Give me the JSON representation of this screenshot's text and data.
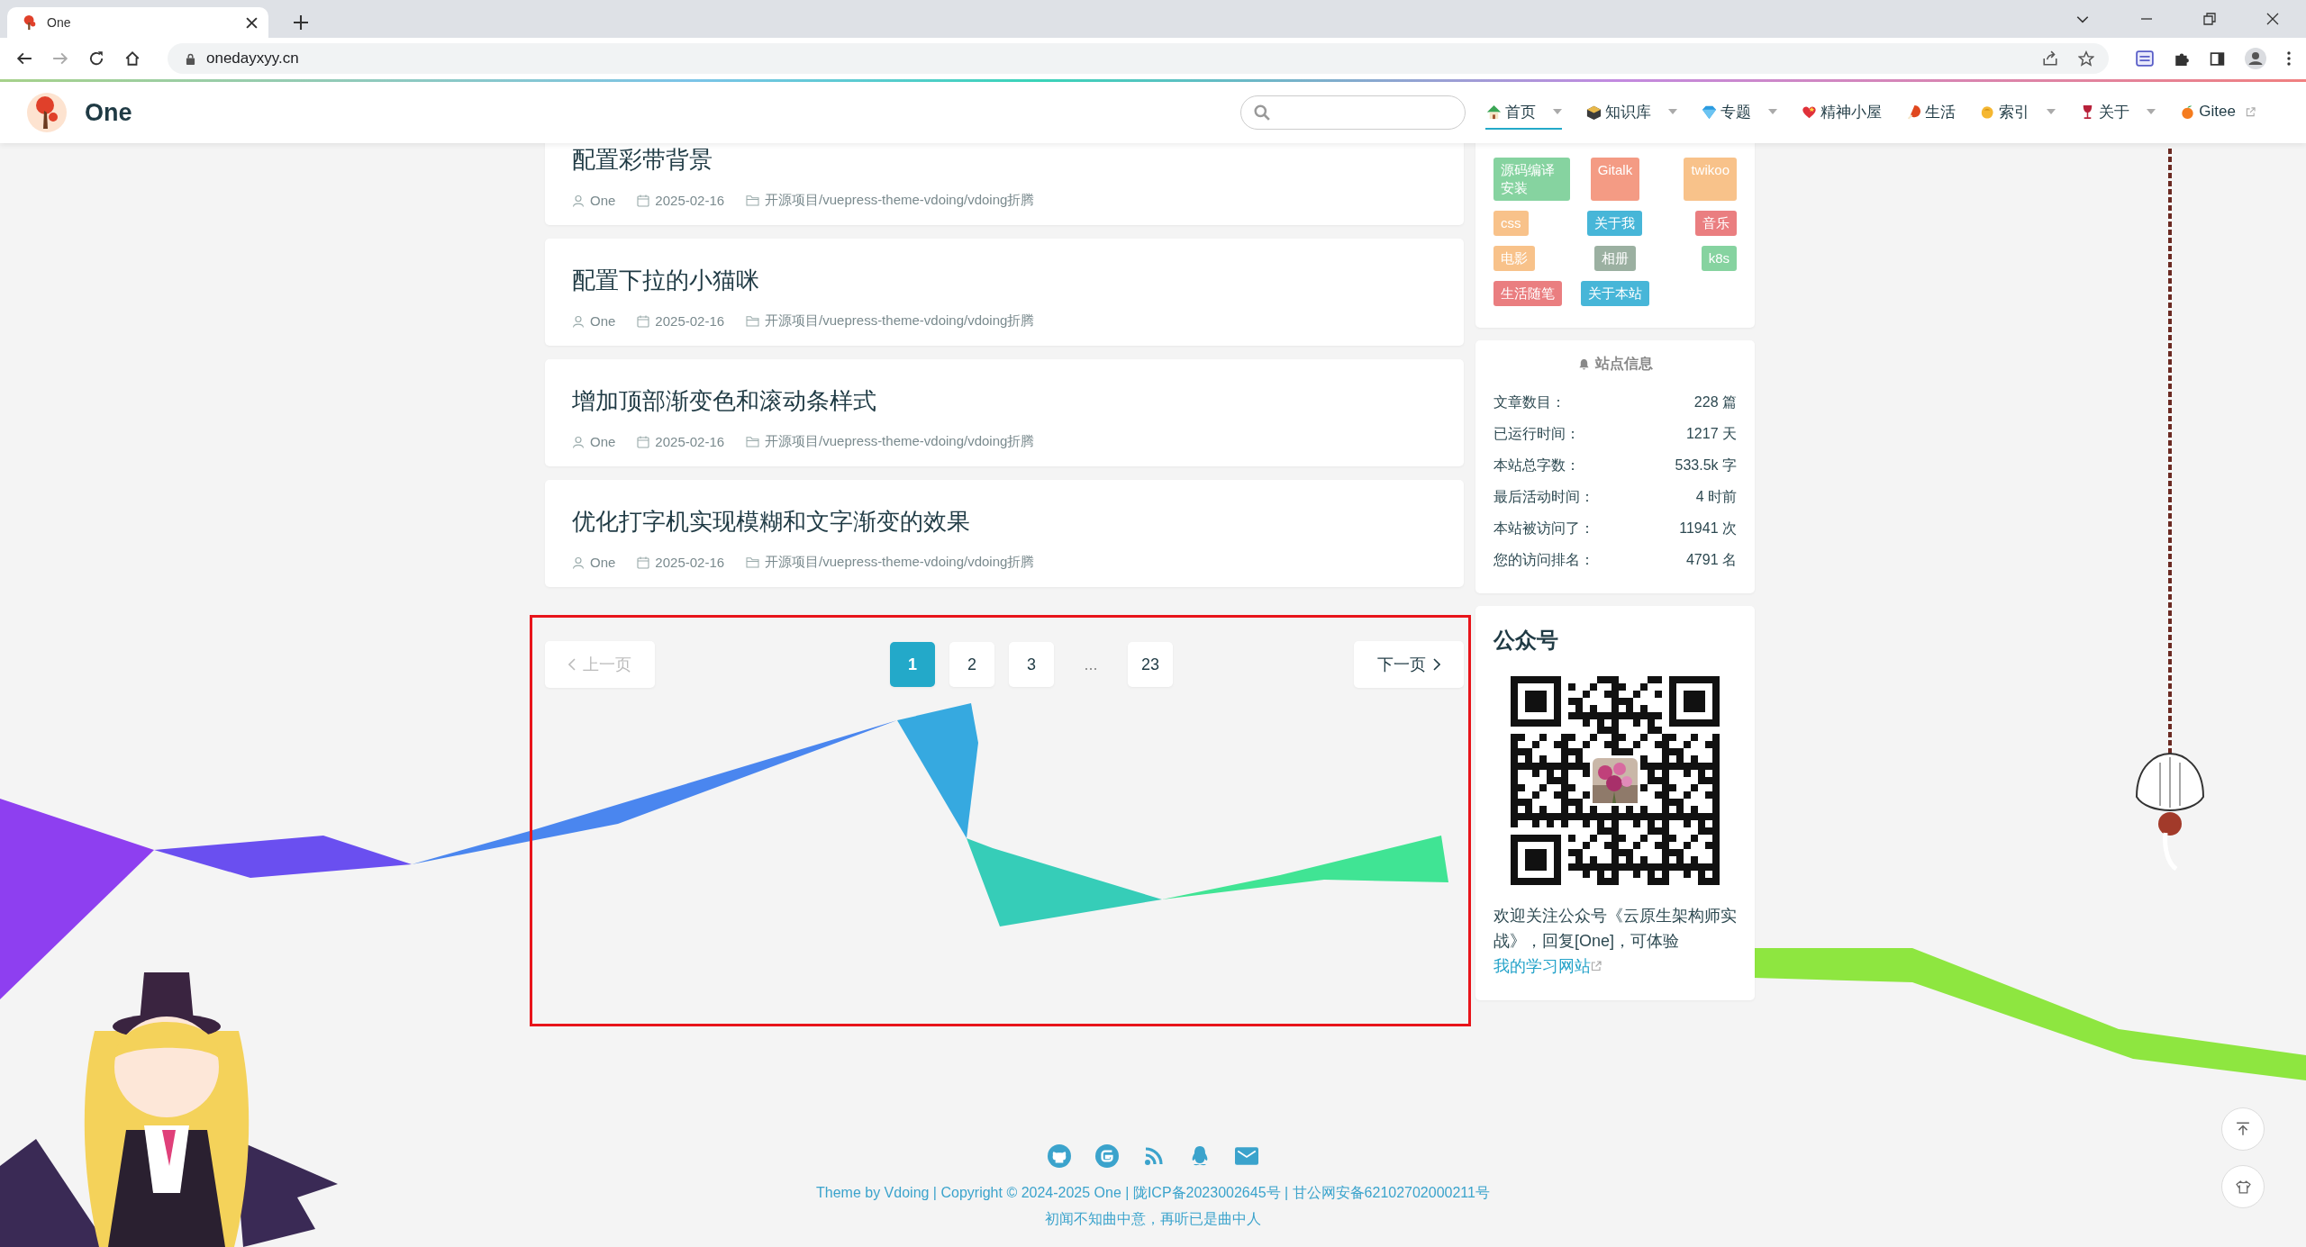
{
  "browser": {
    "tab_title": "One",
    "url": "onedayxyy.cn"
  },
  "site": {
    "title": "One"
  },
  "nav": [
    {
      "label": "首页",
      "selected": true,
      "dropdown": true,
      "external": false
    },
    {
      "label": "知识库",
      "selected": false,
      "dropdown": true,
      "external": false
    },
    {
      "label": "专题",
      "selected": false,
      "dropdown": true,
      "external": false
    },
    {
      "label": "精神小屋",
      "selected": false,
      "dropdown": false,
      "external": false
    },
    {
      "label": "生活",
      "selected": false,
      "dropdown": false,
      "external": false
    },
    {
      "label": "索引",
      "selected": false,
      "dropdown": true,
      "external": false
    },
    {
      "label": "关于",
      "selected": false,
      "dropdown": true,
      "external": false
    },
    {
      "label": "Gitee",
      "selected": false,
      "dropdown": false,
      "external": true
    }
  ],
  "posts": [
    {
      "title": "配置彩带背景",
      "author": "One",
      "date": "2025-02-16",
      "category": "开源项目/vuepress-theme-vdoing/vdoing折腾"
    },
    {
      "title": "配置下拉的小猫咪",
      "author": "One",
      "date": "2025-02-16",
      "category": "开源项目/vuepress-theme-vdoing/vdoing折腾"
    },
    {
      "title": "增加顶部渐变色和滚动条样式",
      "author": "One",
      "date": "2025-02-16",
      "category": "开源项目/vuepress-theme-vdoing/vdoing折腾"
    },
    {
      "title": "优化打字机实现模糊和文字渐变的效果",
      "author": "One",
      "date": "2025-02-16",
      "category": "开源项目/vuepress-theme-vdoing/vdoing折腾"
    }
  ],
  "pagination": {
    "prev": {
      "label": "上一页",
      "disabled": true
    },
    "pages": [
      {
        "label": "1",
        "selected": true
      },
      {
        "label": "2",
        "selected": false
      },
      {
        "label": "3",
        "selected": false
      },
      {
        "label": "...",
        "kind": "ellipsis"
      },
      {
        "label": "23",
        "selected": false
      }
    ],
    "next": {
      "label": "下一页",
      "disabled": false
    }
  },
  "tags": [
    {
      "label": "源码编译安装",
      "color": "#86d3a0"
    },
    {
      "label": "Gitalk",
      "color": "#f49b84"
    },
    {
      "label": "twikoo",
      "color": "#f8c28a"
    },
    {
      "label": "css",
      "color": "#f8c28a"
    },
    {
      "label": "关于我",
      "color": "#47b6d8"
    },
    {
      "label": "音乐",
      "color": "#ea7e80"
    },
    {
      "label": "电影",
      "color": "#f8c28a"
    },
    {
      "label": "相册",
      "color": "#9bb0a1"
    },
    {
      "label": "k8s",
      "color": "#86d3a0"
    },
    {
      "label": "生活随笔",
      "color": "#ea7e80"
    },
    {
      "label": "关于本站",
      "color": "#47b6d8"
    }
  ],
  "site_info": {
    "title": "站点信息",
    "rows": [
      {
        "label": "文章数目：",
        "value": "228 篇"
      },
      {
        "label": "已运行时间：",
        "value": "1217 天"
      },
      {
        "label": "本站总字数：",
        "value": "533.5k 字"
      },
      {
        "label": "最后活动时间：",
        "value": "4 时前"
      },
      {
        "label": "本站被访问了：",
        "value": "11941 次"
      },
      {
        "label": "您的访问排名：",
        "value": "4791 名"
      }
    ]
  },
  "wechat": {
    "title": "公众号",
    "caption": "欢迎关注公众号《云原生架构师实战》，回复[One]，可体验",
    "link": "我的学习网站"
  },
  "footer": {
    "copyright": "Theme by Vdoing | Copyright © 2024-2025 One | 陇ICP备2023002645号 | 甘公网安备62102702000211号",
    "motto": "初闻不知曲中意，再听已是曲中人"
  }
}
